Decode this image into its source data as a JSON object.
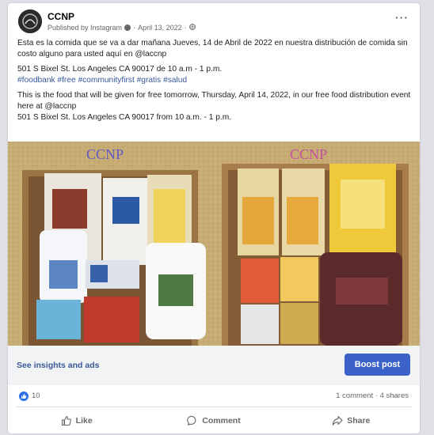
{
  "post": {
    "page_name": "CCNP",
    "published_by": "Published by Instagram",
    "date": "April 13, 2022",
    "more_label": "···",
    "paragraphs": {
      "es_line": "Esta es la comida que se va a dar mañana Jueves, 14 de Abril de 2022 en nuestra distribución de comida sin costo alguno para usted aquí en @laccnp",
      "es_address": "501 S Bixel St. Los Angeles CA 90017 de 10 a.m - 1 p.m.",
      "hashtags": "#foodbank #free #communityfirst #gratis #salud",
      "en_line": "This is the food that will be given for free tomorrow, Thursday, April 14, 2022, in our free food distribution event here at @laccnp",
      "en_address": "501 S Bixel St. Los Angeles CA 90017 from 10 a.m. - 1 p.m."
    },
    "photo": {
      "watermark_left": "CCNP",
      "watermark_right": "CCNP"
    }
  },
  "insights": {
    "link_label": "See insights and ads",
    "boost_label": "Boost post"
  },
  "reactions": {
    "like_count": "10",
    "comments": "1 comment",
    "shares": "4 shares"
  },
  "actions": {
    "like": "Like",
    "comment": "Comment",
    "share": "Share"
  },
  "colors": {
    "accent": "#3b62c8",
    "link": "#385898",
    "like_badge": "#2d6fe8",
    "insights_bg": "#f2f3f5"
  },
  "icons": {
    "globe": "globe-icon",
    "more": "more-icon",
    "like": "thumbs-up-icon",
    "comment": "comment-icon",
    "share": "share-icon"
  }
}
